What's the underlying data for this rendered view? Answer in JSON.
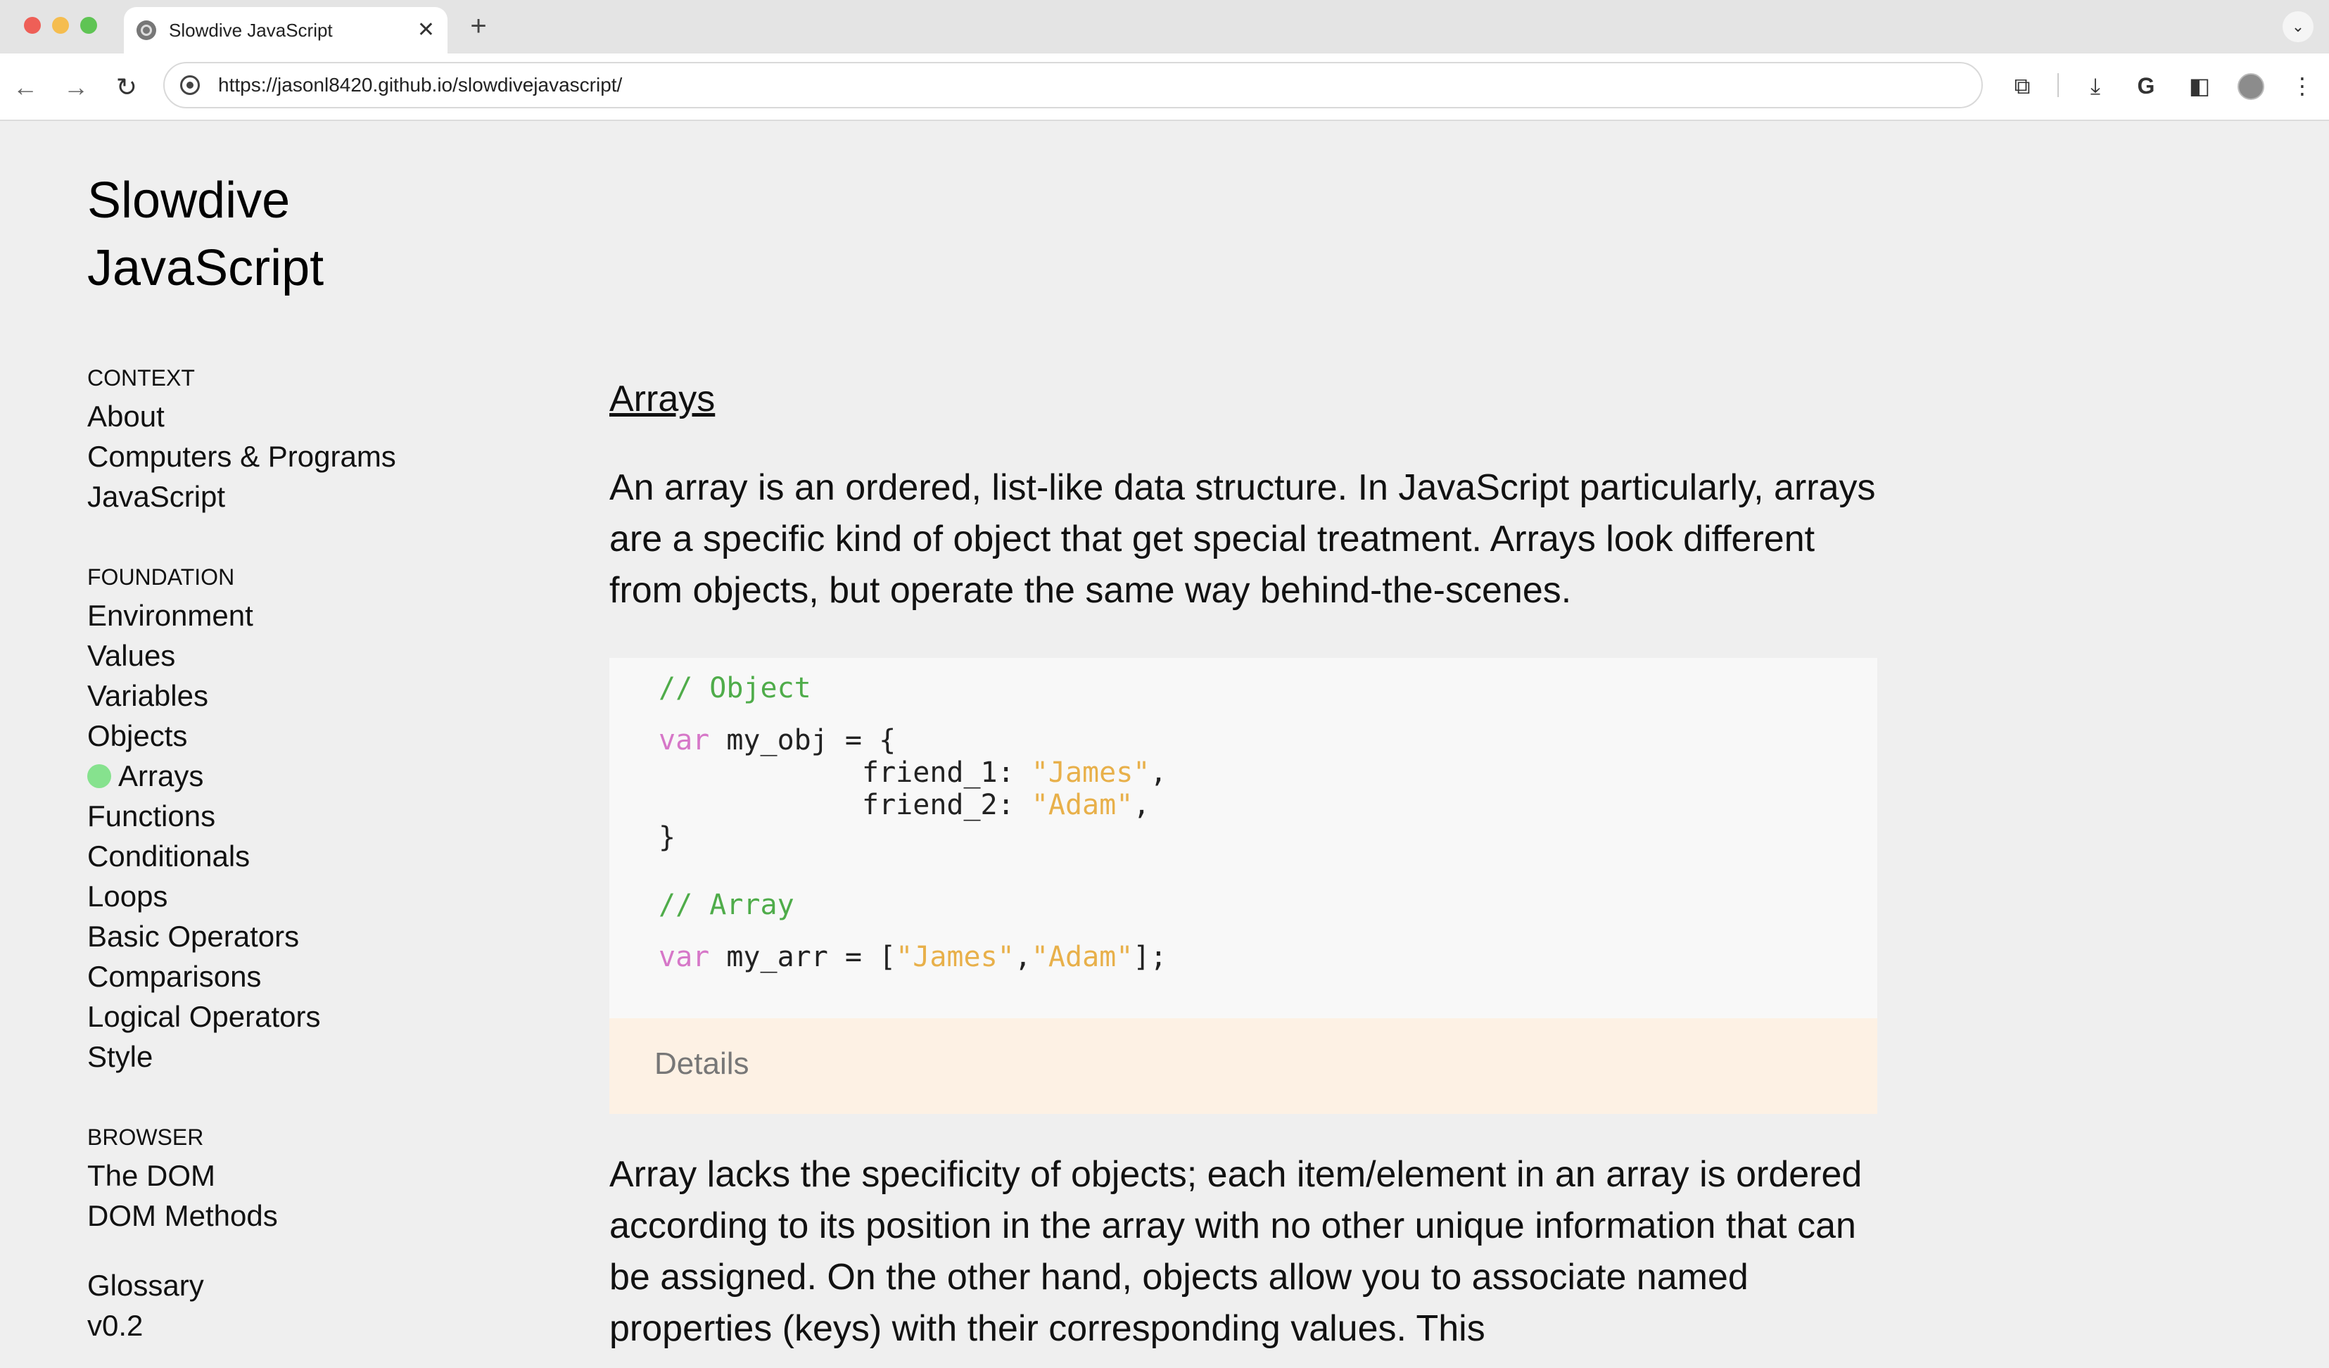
{
  "browser": {
    "tab_title": "Slowdive JavaScript",
    "tab_close": "✕",
    "new_tab": "+",
    "url": "https://jasonl8420.github.io/slowdivejavascript/"
  },
  "site": {
    "title_line1": "Slowdive",
    "title_line2": "JavaScript"
  },
  "nav": {
    "context_heading": "CONTEXT",
    "context_items": [
      "About",
      "Computers & Programs",
      "JavaScript"
    ],
    "foundation_heading": "FOUNDATION",
    "foundation_items": [
      "Environment",
      "Values",
      "Variables",
      "Objects",
      "Arrays",
      "Functions",
      "Conditionals",
      "Loops",
      "Basic Operators",
      "Comparisons",
      "Logical Operators",
      "Style"
    ],
    "browser_heading": "BROWSER",
    "browser_items": [
      "The DOM",
      "DOM Methods"
    ],
    "footer_items": [
      "Glossary",
      "v0.2"
    ],
    "active_item": "Arrays"
  },
  "article": {
    "title": "Arrays",
    "intro": "An array is an ordered, list-like data structure. In JavaScript particularly, arrays are a specific kind of object that get special treatment. Arrays look different from objects, but operate the same way behind-the-scenes.",
    "code": {
      "comment_object": "// Object",
      "kw_var": "var",
      "obj_decl": " my_obj = {",
      "friend_1_key": "            friend_1: ",
      "friend_1_val": "\"James\"",
      "friend_2_key": "            friend_2: ",
      "friend_2_val": "\"Adam\"",
      "comma": ",",
      "obj_close": "}",
      "comment_array": "// Array",
      "arr_decl": " my_arr = [",
      "arr_val_1": "\"James\"",
      "arr_val_2": "\"Adam\"",
      "arr_close": "];"
    },
    "details_label": "Details",
    "body": "Array lacks the specificity of objects; each item/element in an array is ordered according to its position in the array with no other unique information that can be assigned. On the other hand, objects allow you to associate named properties (keys) with their corresponding values. This"
  },
  "colors": {
    "active_dot": "#86e28e",
    "code_comment": "#4fac4a",
    "code_keyword": "#d677c8",
    "code_string": "#e8b04a",
    "details_bg": "#fdf1e4"
  },
  "icons": {
    "back": "arrow-left-icon",
    "forward": "arrow-right-icon",
    "reload": "reload-icon",
    "extensions": "puzzle-icon",
    "download": "download-icon",
    "google": "google-icon",
    "sidepanel": "side-panel-icon",
    "menu": "more-vert-icon"
  }
}
